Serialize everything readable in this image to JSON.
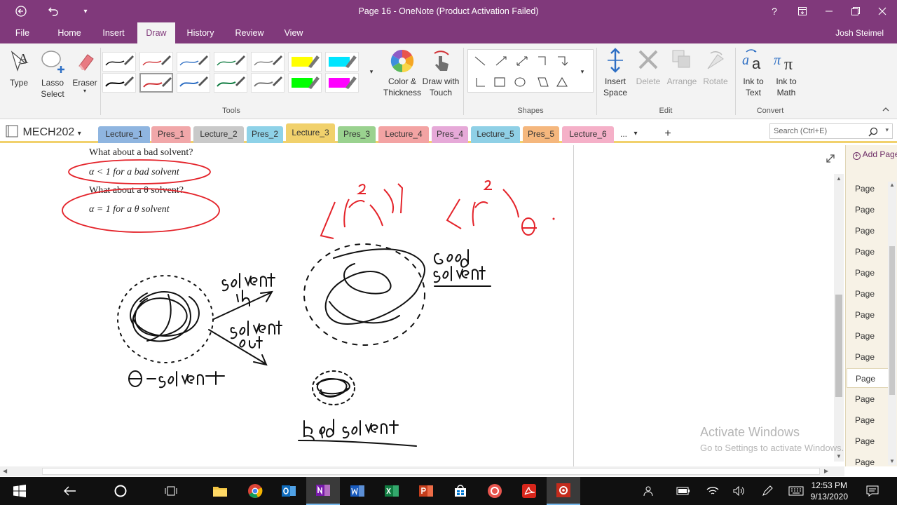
{
  "titlebar": {
    "title": "Page 16 - OneNote (Product Activation Failed)",
    "qat": [
      "back-icon",
      "undo-icon",
      "customize-icon"
    ],
    "help": "?"
  },
  "ribbon_tabs": [
    "File",
    "Home",
    "Insert",
    "Draw",
    "History",
    "Review",
    "View"
  ],
  "active_tab": "Draw",
  "user": "Josh Steimel",
  "tools": {
    "type": "Type",
    "lasso_line1": "Lasso",
    "lasso_line2": "Select",
    "eraser": "Eraser",
    "label": "Tools"
  },
  "pens": {
    "row1": [
      "#000000",
      "#d13438",
      "#2e6fc4",
      "#107c41",
      "#7a7a7a",
      "#ffff00",
      "#00e5ff"
    ],
    "row2": [
      "#000000",
      "#d13438",
      "#2e6fc4",
      "#107c41",
      "#7a7a7a",
      "#00ff00",
      "#ff00ff"
    ]
  },
  "color_thickness": {
    "line1": "Color &",
    "line2": "Thickness"
  },
  "draw_touch": {
    "line1": "Draw with",
    "line2": "Touch"
  },
  "shapes_label": "Shapes",
  "edit": {
    "insert_space_1": "Insert",
    "insert_space_2": "Space",
    "delete": "Delete",
    "arrange": "Arrange",
    "rotate": "Rotate",
    "label": "Edit"
  },
  "convert": {
    "ink_text_1": "Ink to",
    "ink_text_2": "Text",
    "ink_math_1": "Ink to",
    "ink_math_2": "Math",
    "label": "Convert"
  },
  "notebook": "MECH202",
  "sections": [
    {
      "label": "Lecture_1",
      "color": "#8fb5e0"
    },
    {
      "label": "Pres_1",
      "color": "#f1a7a9"
    },
    {
      "label": "Lecture_2",
      "color": "#c9c9c9"
    },
    {
      "label": "Pres_2",
      "color": "#8ed2e8"
    },
    {
      "label": "Lecture_3",
      "color": "#f1d16c"
    },
    {
      "label": "Pres_3",
      "color": "#9ad28f"
    },
    {
      "label": "Lecture_4",
      "color": "#f3a3a3"
    },
    {
      "label": "Pres_4",
      "color": "#e6a9d8"
    },
    {
      "label": "Lecture_5",
      "color": "#8fd0e6"
    },
    {
      "label": "Pres_5",
      "color": "#f5b77d"
    },
    {
      "label": "Lecture_6",
      "color": "#f5b0c8"
    }
  ],
  "more_sections": "...",
  "add_section": "+",
  "search_placeholder": "Search (Ctrl+E)",
  "content": {
    "q1": "What about a bad solvent?",
    "a1": "α < 1 for a bad solvent",
    "q2": "What about a θ solvent?",
    "a2": "α = 1 for a θ solvent"
  },
  "pages": {
    "add": "Add Page",
    "items": [
      "Page",
      "Page",
      "Page",
      "Page",
      "Page",
      "Page",
      "Page",
      "Page",
      "Page",
      "Page",
      "Page",
      "Page",
      "Page",
      "Page"
    ],
    "selected_index": 9
  },
  "watermark": {
    "line1": "Activate Windows",
    "line2": "Go to Settings to activate Windows."
  },
  "clock": {
    "time": "12:53 PM",
    "date": "9/13/2020"
  }
}
